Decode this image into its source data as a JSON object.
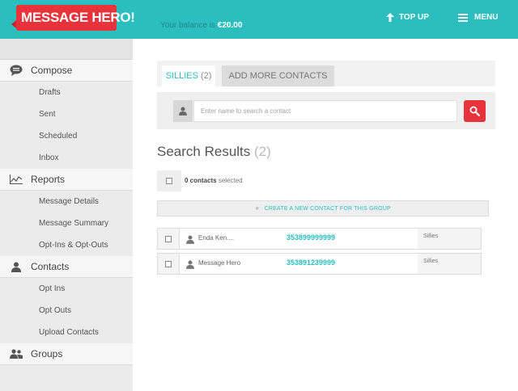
{
  "header": {
    "logo_text": "MESSAGE HERO!",
    "balance_label": "Your balance is",
    "balance_value": "€20.00",
    "topup_label": "TOP UP",
    "menu_label": "MENU",
    "bar_color": "#2cbdbf",
    "brand_color": "#e8323c"
  },
  "sidebar": {
    "sections": [
      {
        "label": "Compose",
        "icon": "chat-bubble-icon",
        "items": [
          "Drafts",
          "Sent",
          "Scheduled",
          "Inbox"
        ]
      },
      {
        "label": "Reports",
        "icon": "line-chart-icon",
        "items": [
          "Message Details",
          "Message Summary",
          "Opt-Ins & Opt-Outs"
        ]
      },
      {
        "label": "Contacts",
        "icon": "person-icon",
        "items": [
          "Opt Ins",
          "Opt Outs",
          "Upload Contacts"
        ]
      },
      {
        "label": "Groups",
        "icon": "group-icon",
        "items": []
      }
    ]
  },
  "tabs": {
    "active_label": "SILLIES",
    "active_count": "(2)",
    "add_label": "ADD MORE CONTACTS"
  },
  "search": {
    "placeholder": "Enter name to search a contact"
  },
  "results": {
    "title": "Search Results",
    "count": "(2)",
    "selected_count": "0 contacts",
    "selected_suffix": "selected",
    "create_label": "CREATE A NEW CONTACT FOR THIS GROUP",
    "rows": [
      {
        "name": "Enda Ken....",
        "phone": "353899999999",
        "group": "Sillies"
      },
      {
        "name": "Message Hero",
        "phone": "353891239999",
        "group": "Sillies"
      }
    ]
  }
}
